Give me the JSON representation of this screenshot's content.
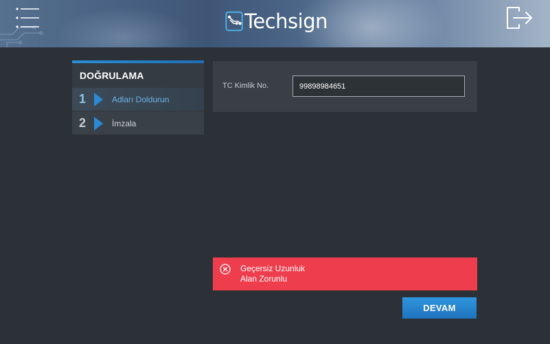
{
  "header": {
    "logo_text": "Techsign",
    "menu_icon": "menu-icon",
    "logout_icon": "logout-icon"
  },
  "steps": {
    "title": "DOĞRULAMA",
    "items": [
      {
        "number": "1",
        "label": "Adları Doldurun",
        "active": true
      },
      {
        "number": "2",
        "label": "İmzala",
        "active": false
      }
    ]
  },
  "form": {
    "tc_label": "TC Kimlik No.",
    "tc_value": "99898984651"
  },
  "error": {
    "icon": "error-circle-icon",
    "messages": [
      "Geçersiz Uzunluk",
      "Alan Zorunlu"
    ]
  },
  "actions": {
    "continue_label": "DEVAM"
  },
  "colors": {
    "accent": "#2a8ad6",
    "error": "#ee3e4e",
    "background": "#2c3137"
  }
}
